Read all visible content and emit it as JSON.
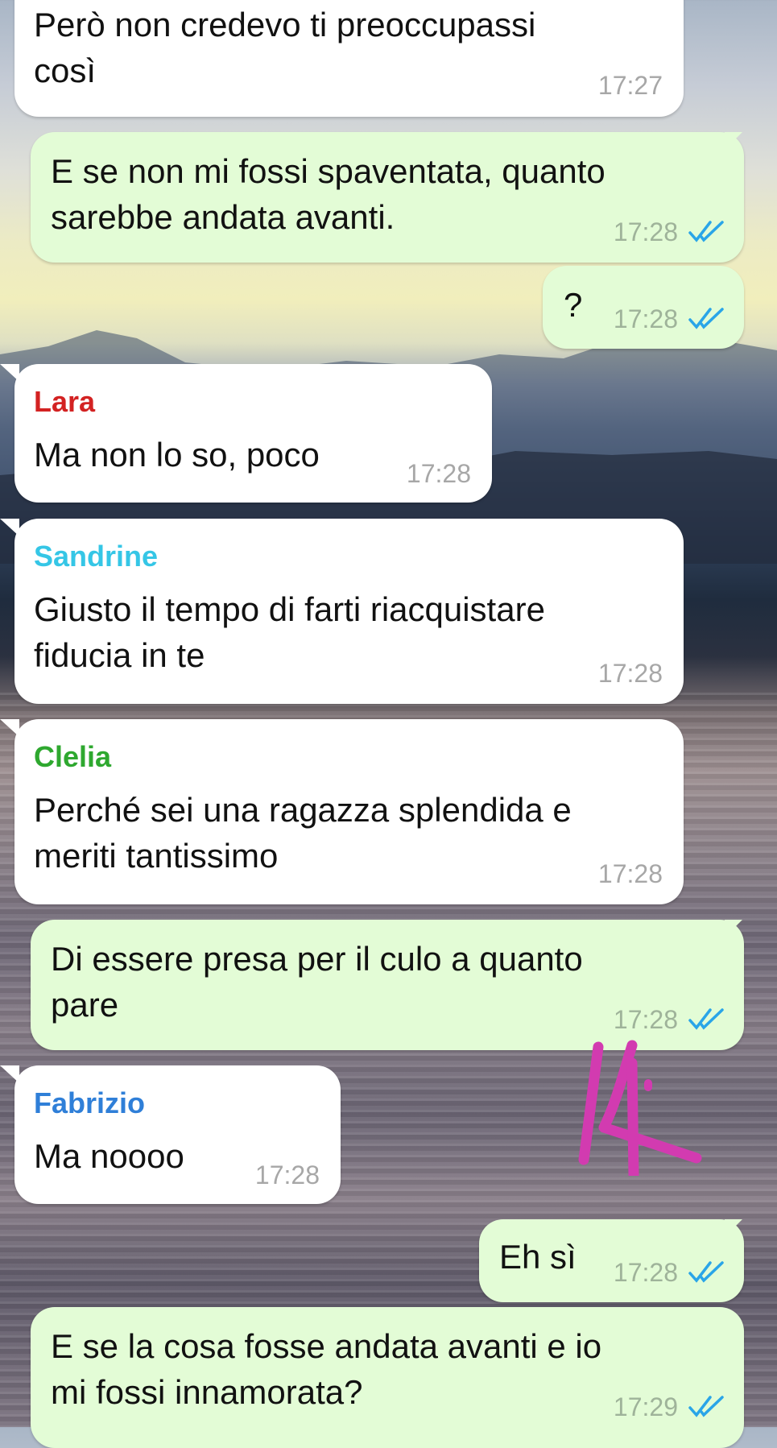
{
  "colors": {
    "incoming_bg": "#ffffff",
    "outgoing_bg": "#e3fcd6",
    "sender_lara": "#d32222",
    "sender_sandrine": "#35c6e6",
    "sender_clelia": "#2ea82f",
    "sender_fabrizio": "#2f7fd8",
    "read_ticks": "#2aa5e8",
    "timestamp": "#a7a7a7",
    "scribble": "#d23bb0"
  },
  "messages": [
    {
      "direction": "in",
      "sender": "",
      "text": "Però non credevo ti preoccupassi\ncosì",
      "time": "17:27"
    },
    {
      "direction": "out",
      "text": "E se non mi fossi spaventata, quanto\nsarebbe andata avanti.",
      "time": "17:28",
      "status_icon": "double-check-icon"
    },
    {
      "direction": "out",
      "text": "?",
      "time": "17:28",
      "status_icon": "double-check-icon"
    },
    {
      "direction": "in",
      "sender": "Lara",
      "text": "Ma non lo so, poco",
      "time": "17:28"
    },
    {
      "direction": "in",
      "sender": "Sandrine",
      "text": "Giusto il tempo di farti riacquistare\nfiducia in te",
      "time": "17:28"
    },
    {
      "direction": "in",
      "sender": "Clelia",
      "text": "Perché sei una ragazza splendida e\nmeriti tantissimo",
      "time": "17:28"
    },
    {
      "direction": "out",
      "text": "Di essere presa per il culo a quanto\npare",
      "time": "17:28",
      "status_icon": "double-check-icon"
    },
    {
      "direction": "in",
      "sender": "Fabrizio",
      "text": "Ma noooo",
      "time": "17:28"
    },
    {
      "direction": "out",
      "text": "Eh sì",
      "time": "17:28",
      "status_icon": "double-check-icon"
    },
    {
      "direction": "out",
      "text": "E se la cosa fosse andata avanti e io\nmi fossi innamorata?",
      "time": "17:29",
      "status_icon": "double-check-icon"
    }
  ],
  "overlay": {
    "icon": "handwritten-scribble-icon"
  }
}
